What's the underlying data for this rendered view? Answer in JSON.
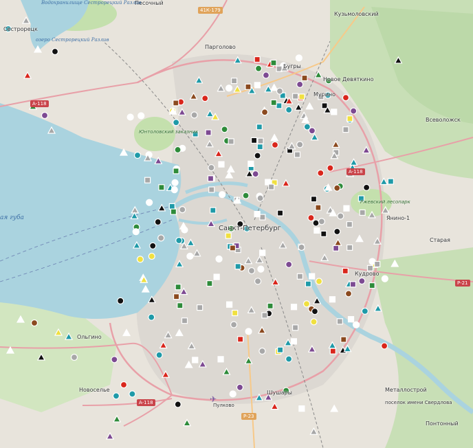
{
  "map": {
    "labels": [
      {
        "id": "sestroretsk",
        "text": "Сестрорецк"
      },
      {
        "id": "pargolovo",
        "text": "Парголово"
      },
      {
        "id": "kuzmolovsky",
        "text": "Кузьмоловский"
      },
      {
        "id": "novoe-devyatkino",
        "text": "Новое Девяткино"
      },
      {
        "id": "murino",
        "text": "Мурино"
      },
      {
        "id": "bugry",
        "text": "Бугры"
      },
      {
        "id": "vsevolozhsk",
        "text": "Всеволожск"
      },
      {
        "id": "yanino",
        "text": "Янино-1"
      },
      {
        "id": "staraya",
        "text": "Старая"
      },
      {
        "id": "kudrovo",
        "text": "Кудрово"
      },
      {
        "id": "spb",
        "text": "Санкт-Петербург"
      },
      {
        "id": "novoselye",
        "text": "Новоселье"
      },
      {
        "id": "shushary",
        "text": "Шушары"
      },
      {
        "id": "metallostroy",
        "text": "Металлострой"
      },
      {
        "id": "sverdlova",
        "text": "поселок имени Свердлова"
      },
      {
        "id": "pontonny",
        "text": "Понтонный"
      },
      {
        "id": "olgino",
        "text": "Ольгино"
      },
      {
        "id": "pesochny",
        "text": "Песочный"
      },
      {
        "id": "pulkovo",
        "text": "Пулково"
      }
    ],
    "water_labels": [
      {
        "id": "gulf",
        "text": "ая губа"
      },
      {
        "id": "razliv",
        "text": "озеро Сестрорецкий Разлив"
      },
      {
        "id": "vodokhranilishche",
        "text": "Водохранилище Сестрорецкий Разлив"
      }
    ],
    "park_labels": [
      {
        "id": "yuntolovsky",
        "text": "Юнтоловский заказник"
      },
      {
        "id": "rzhevsky",
        "text": "Ржевский лесопарк"
      }
    ],
    "road_shields": [
      {
        "id": "a118-west",
        "text": "A-118"
      },
      {
        "id": "a118-east",
        "text": "A-118"
      },
      {
        "id": "a118-south",
        "text": "A-118"
      },
      {
        "id": "41k179",
        "text": "41К-179"
      },
      {
        "id": "r21",
        "text": "P-21"
      },
      {
        "id": "r23",
        "text": "P-23"
      }
    ],
    "colors": {
      "land": "#e8e4dc",
      "urban": "#dcd8d2",
      "water": "#aad3df",
      "park": "#c8e2b2",
      "forest": "#aed1a0",
      "road_major": "#e8a0a8",
      "road_trunk": "#f7c989",
      "rail": "#888888",
      "marker_teal": "#1f9aa8",
      "marker_gray": "#a8a8a8",
      "marker_white": "#ffffff",
      "marker_black": "#111111",
      "marker_red": "#d9261c",
      "marker_green": "#2e8b3a",
      "marker_purple": "#7d4a92",
      "marker_yellow": "#f0e040",
      "marker_brown": "#8b4a1f"
    }
  }
}
